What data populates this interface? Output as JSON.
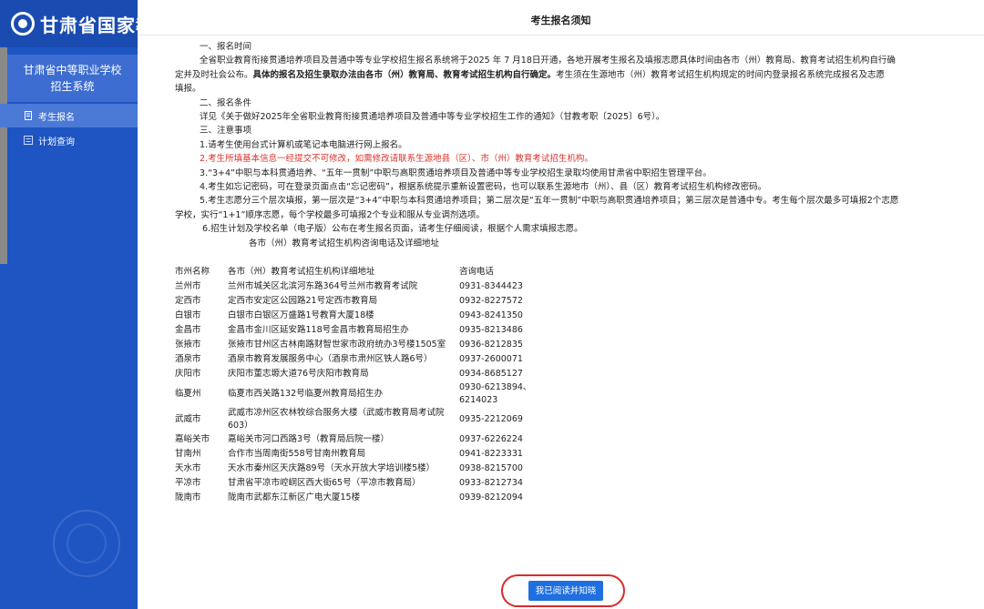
{
  "app": {
    "title": "甘肃省国家教",
    "system_name_line1": "甘肃省中等职业学校",
    "system_name_line2": "招生系统"
  },
  "nav": {
    "items": [
      {
        "label": "考生报名",
        "active": true
      },
      {
        "label": "计划查询",
        "active": false
      }
    ]
  },
  "modal": {
    "title": "考生报名须知",
    "s1_heading": "一、报名时间",
    "s1_p1a": "全省职业教育衔接贯通培养项目及普通中等专业学校招生报名系统将于2025 年 7 月18日开通，各地开展考生报名及填报志愿具体时间由各市（州）教育局、教育考试招生机构自行确",
    "s1_p1b": "定并及时社会公布。",
    "s1_p1_bold": "具体的报名及招生录取办法由各市（州）教育局、教育考试招生机构自行确定。",
    "s1_p1c": "考生须在生源地市（州）教育考试招生机构规定的时间内登录报名系统完成报名及志愿",
    "s1_p1d": "填报。",
    "s2_heading": "二、报名条件",
    "s2_p1": "详见《关于做好2025年全省职业教育衔接贯通培养项目及普通中等专业学校招生工作的通知》（甘教考职〔2025〕6号）。",
    "s3_heading": "三、注意事项",
    "s3_item1": "1.请考生使用台式计算机或笔记本电脑进行网上报名。",
    "s3_item2": "2.考生所填基本信息一经提交不可修改，如需修改请联系生源地县（区）、市（州）教育考试招生机构。",
    "s3_item3": "3.“3+4”中职与本科贯通培养、“五年一贯制”中职与高职贯通培养项目及普通中等专业学校招生录取均使用甘肃省中职招生管理平台。",
    "s3_item4": "4.考生如忘记密码，可在登录页面点击“忘记密码”，根据系统提示重新设置密码，也可以联系生源地市（州）、县（区）教育考试招生机构修改密码。",
    "s3_item5a": "5.考生志愿分三个层次填报，第一层次是“3+4”中职与本科贯通培养项目；第二层次是“五年一贯制”中职与高职贯通培养项目；第三层次是普通中专。考生每个层次最多可填报2个志愿",
    "s3_item5b": "学校，实行“1+1”顺序志愿，每个学校最多可填报2个专业和服从专业调剂选项。",
    "s3_item6": "6.招生计划及学校名单（电子版）公布在考生报名页面，请考生仔细阅读，根据个人需求填报志愿。",
    "table_caption": "各市（州）教育考试招生机构咨询电话及详细地址",
    "table_headers": [
      "市州名称",
      "各市（州）教育考试招生机构详细地址",
      "咨询电话"
    ],
    "contacts": [
      {
        "city": "兰州市",
        "address": "兰州市城关区北滨河东路364号兰州市教育考试院",
        "phone": "0931-8344423"
      },
      {
        "city": "定西市",
        "address": "定西市安定区公园路21号定西市教育局",
        "phone": "0932-8227572"
      },
      {
        "city": "白银市",
        "address": "白银市白银区万盛路1号教育大厦18楼",
        "phone": "0943-8241350"
      },
      {
        "city": "金昌市",
        "address": "金昌市金川区延安路118号金昌市教育局招生办",
        "phone": "0935-8213486"
      },
      {
        "city": "张掖市",
        "address": "张掖市甘州区古林南路财智世家市政府统办3号楼1505室",
        "phone": "0936-8212835"
      },
      {
        "city": "酒泉市",
        "address": "酒泉市教育发展服务中心（酒泉市肃州区铁人路6号）",
        "phone": "0937-2600071"
      },
      {
        "city": "庆阳市",
        "address": "庆阳市董志塬大道76号庆阳市教育局",
        "phone": "0934-8685127"
      },
      {
        "city": "临夏州",
        "address": "临夏市西关路132号临夏州教育局招生办",
        "phone": "0930-6213894、6214023"
      },
      {
        "city": "武威市",
        "address": "武威市凉州区农林牧综合服务大楼（武威市教育局考试院603）",
        "phone": "0935-2212069"
      },
      {
        "city": "嘉峪关市",
        "address": "嘉峪关市河口西路3号（教育局后院一楼）",
        "phone": "0937-6226224"
      },
      {
        "city": "甘南州",
        "address": "合作市当周南街558号甘南州教育局",
        "phone": "0941-8223331"
      },
      {
        "city": "天水市",
        "address": "天水市秦州区天庆路89号（天水开放大学培训楼5楼）",
        "phone": "0938-8215700"
      },
      {
        "city": "平凉市",
        "address": "甘肃省平凉市崆峒区西大街65号（平凉市教育局）",
        "phone": "0933-8212734"
      },
      {
        "city": "陇南市",
        "address": "陇南市武都东江新区广电大厦15楼",
        "phone": "0939-8212094"
      }
    ],
    "confirm_label": "我已阅读并知晓"
  },
  "colors": {
    "sidebar": "#1f55c2",
    "accent_button": "#1f6fe0",
    "highlight_ring": "#d92a2a",
    "warning_text": "#d9342b"
  }
}
